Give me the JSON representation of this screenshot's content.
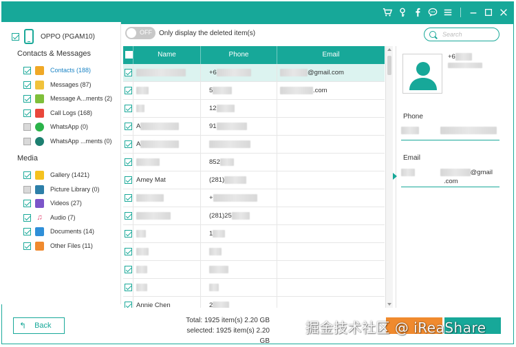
{
  "titlebar": {
    "icons": [
      "cart-icon",
      "key-icon",
      "facebook-icon",
      "chat-icon",
      "menu-icon",
      "minimize-icon",
      "maximize-icon",
      "close-icon"
    ],
    "accent": "#17a899"
  },
  "device": {
    "name": "OPPO (PGAM10)",
    "checked": true
  },
  "sections": {
    "contacts_title": "Contacts & Messages",
    "media_title": "Media"
  },
  "nav": {
    "contacts": "Contacts (188)",
    "messages": "Messages (87)",
    "message_attachments": "Message A...ments (2)",
    "call_logs": "Call Logs (168)",
    "whatsapp": "WhatsApp (0)",
    "whatsapp_attachments": "WhatsApp ...ments (0)",
    "gallery": "Gallery (1421)",
    "picture_library": "Picture Library (0)",
    "videos": "Videos (27)",
    "audio": "Audio (7)",
    "documents": "Documents (14)",
    "other_files": "Other Files (11)"
  },
  "toolbar": {
    "toggle_label": "OFF",
    "only_deleted_label": "Only display the deleted item(s)",
    "search_placeholder": "Search"
  },
  "table": {
    "headers": {
      "name": "Name",
      "phone": "Phone",
      "email": "Email"
    },
    "rows": [
      {
        "name": "",
        "phone": "+6",
        "email": "@gmail.com"
      },
      {
        "name": "",
        "phone": "5",
        "email": ".com"
      },
      {
        "name": "",
        "phone": "12",
        "email": ""
      },
      {
        "name": "A",
        "phone": "91",
        "email": ""
      },
      {
        "name": "A",
        "phone": "",
        "email": ""
      },
      {
        "name": "",
        "phone": "852",
        "email": ""
      },
      {
        "name": "Amey Mat",
        "phone": "(281)",
        "email": ""
      },
      {
        "name": "",
        "phone": "+",
        "email": ""
      },
      {
        "name": "",
        "phone": "(281)25",
        "email": ""
      },
      {
        "name": "",
        "phone": "1",
        "email": ""
      },
      {
        "name": "",
        "phone": "",
        "email": ""
      },
      {
        "name": "",
        "phone": "",
        "email": ""
      },
      {
        "name": "",
        "phone": "",
        "email": ""
      },
      {
        "name": "Annie Chen",
        "phone": "2",
        "email": ""
      }
    ]
  },
  "detail": {
    "phone_top": "+6",
    "phone_label": "Phone",
    "email_label": "Email",
    "email_value_suffix": "@gmail",
    "email_value_line2": ".com"
  },
  "bottom": {
    "back_label": "Back",
    "total": "Total: 1925 item(s) 2.20 GB",
    "selected": "selected: 1925 item(s) 2.20 GB",
    "watermark": "掘金技术社区 @ iReaShare"
  }
}
